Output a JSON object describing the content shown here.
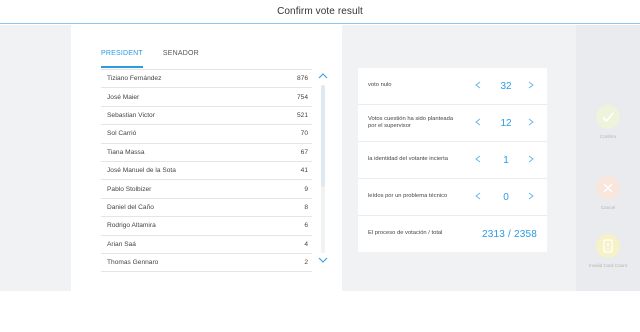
{
  "header": {
    "title": "Confirm vote result"
  },
  "tabs": [
    {
      "label": "PRESIDENT",
      "active": true
    },
    {
      "label": "SENADOR",
      "active": false
    }
  ],
  "candidates": [
    {
      "name": "Tiziano Fernández",
      "count": "876"
    },
    {
      "name": "José Maier",
      "count": "754"
    },
    {
      "name": "Sebastian Victor",
      "count": "521"
    },
    {
      "name": "Sol Carrió",
      "count": "70"
    },
    {
      "name": "Tiana Massa",
      "count": "67"
    },
    {
      "name": "José Manuel de la Sota",
      "count": "41"
    },
    {
      "name": "Pablo Stolbizer",
      "count": "9"
    },
    {
      "name": "Daniel del Caño",
      "count": "8"
    },
    {
      "name": "Rodrigo Altamira",
      "count": "6"
    },
    {
      "name": "Arian Saá",
      "count": "4"
    },
    {
      "name": "Thomas Gennaro",
      "count": "2"
    }
  ],
  "counters": [
    {
      "label": "voto nulo",
      "value": "32"
    },
    {
      "label": "Votos cuestión ha sido planteada por el supervisor",
      "value": "12"
    },
    {
      "label": "la identidad del votante incierta",
      "value": "1"
    },
    {
      "label": "leídos por un problema técnico",
      "value": "0"
    }
  ],
  "total": {
    "label": "El proceso de votación / total",
    "value": "2313 / 2358"
  },
  "actions": {
    "confirm_label": "Confirm",
    "cancel_label": "Cancel",
    "invalid_label": "Invalid Card Count"
  },
  "colors": {
    "accent": "#2b9be0",
    "confirm_bg": "#eef3dc",
    "cancel_bg": "#f8e6dc",
    "invalid_bg": "#f7f1c8",
    "panel_bg": "#f1f2f4"
  }
}
